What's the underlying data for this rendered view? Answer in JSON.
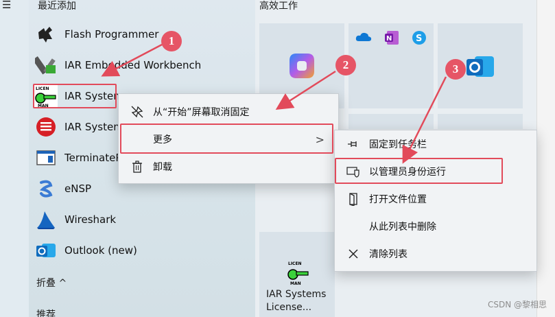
{
  "left": {
    "section_title": "最近添加",
    "apps": [
      {
        "label": "Flash Programmer",
        "icon": "flash-programmer-icon"
      },
      {
        "label": "IAR Embedded Workbench",
        "icon": "iar-workbench-icon"
      },
      {
        "label": "IAR Systems",
        "icon": "license-manager-key-icon"
      },
      {
        "label": "IAR System",
        "icon": "iar-red-icon"
      },
      {
        "label": "TerminateP",
        "icon": "terminate-icon"
      },
      {
        "label": "eNSP",
        "icon": "ensp-icon"
      },
      {
        "label": "Wireshark",
        "icon": "wireshark-icon"
      },
      {
        "label": "Outlook (new)",
        "icon": "outlook-icon"
      }
    ],
    "collapse_label": "折叠",
    "collapse_glyph": "^",
    "recommend_label": "推荐"
  },
  "right": {
    "section_title": "高效工作",
    "license_tile_line1": "IAR Systems",
    "license_tile_line2": "License..."
  },
  "menu1": {
    "items": [
      {
        "label": "从“开始”屏幕取消固定",
        "icon": "unpin-icon"
      },
      {
        "label": "更多",
        "icon": ""
      },
      {
        "label": "卸载",
        "icon": "trash-icon"
      }
    ],
    "more_arrow": ">"
  },
  "menu2": {
    "items": [
      {
        "label": "固定到任务栏",
        "icon": "pin-icon"
      },
      {
        "label": "以管理员身份运行",
        "icon": "shield-icon"
      },
      {
        "label": "打开文件位置",
        "icon": "folder-open-icon"
      },
      {
        "label": "从此列表中删除",
        "icon": ""
      },
      {
        "label": "清除列表",
        "icon": "close-icon"
      }
    ]
  },
  "callouts": [
    "1",
    "2",
    "3"
  ],
  "watermark": "CSDN @黎相思",
  "accent": "#e24a5a"
}
